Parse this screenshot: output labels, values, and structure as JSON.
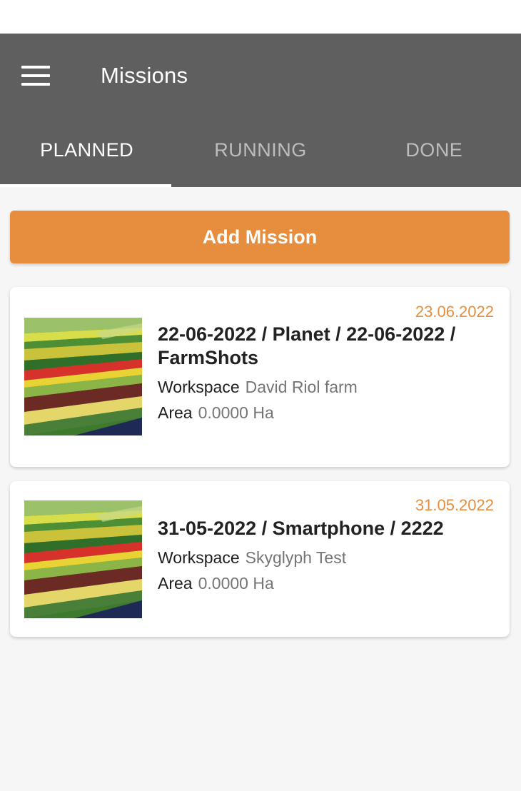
{
  "appbar": {
    "title": "Missions",
    "tabs": [
      {
        "label": "PLANNED",
        "active": true
      },
      {
        "label": "RUNNING",
        "active": false
      },
      {
        "label": "DONE",
        "active": false
      }
    ]
  },
  "actions": {
    "add_mission_label": "Add Mission"
  },
  "missions": [
    {
      "date": "23.06.2022",
      "name": "22-06-2022 / Planet / 22-06-2022 / FarmShots",
      "workspace_label": "Workspace",
      "workspace": "David Riol farm",
      "area_label": "Area",
      "area": "0.0000 Ha"
    },
    {
      "date": "31.05.2022",
      "name": "31-05-2022 / Smartphone / 2222",
      "workspace_label": "Workspace",
      "workspace": "Skyglyph Test",
      "area_label": "Area",
      "area": "0.0000 Ha"
    }
  ],
  "colors": {
    "appbar": "#5f5f5f",
    "accent": "#e68e3d",
    "background": "#f6f6f6"
  },
  "icons": {
    "menu": "hamburger-menu-icon",
    "thumbnail": "field-thumbnail-image"
  }
}
